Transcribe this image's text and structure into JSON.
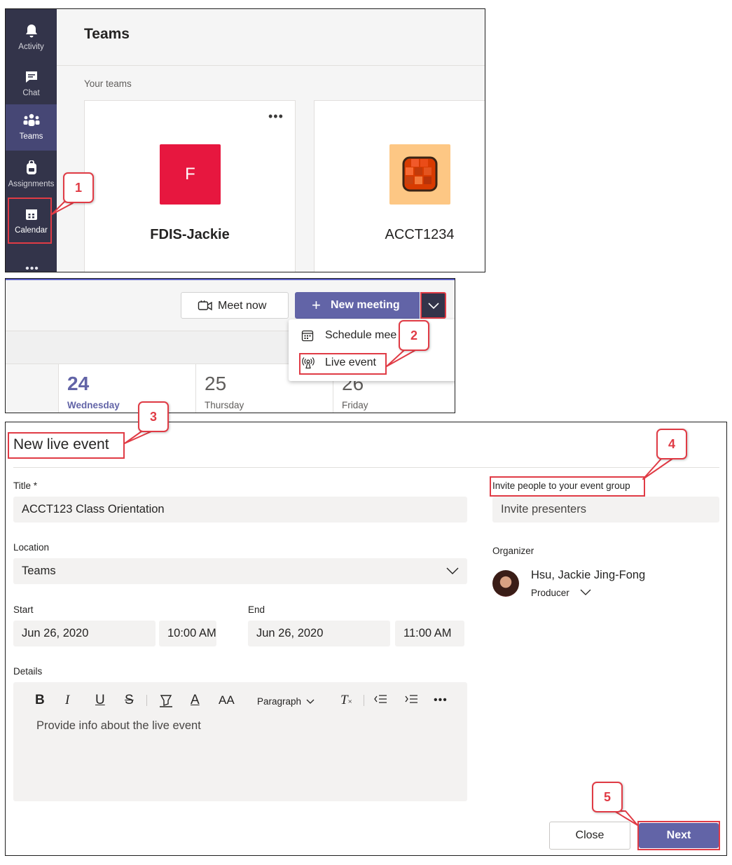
{
  "panel1": {
    "rail": [
      {
        "label": "Activity",
        "icon": "bell-icon"
      },
      {
        "label": "Chat",
        "icon": "chat-icon"
      },
      {
        "label": "Teams",
        "icon": "teams-icon"
      },
      {
        "label": "Assignments",
        "icon": "backpack-icon"
      },
      {
        "label": "Calendar",
        "icon": "calendar-icon"
      }
    ],
    "more": "•••",
    "title": "Teams",
    "section_label": "Your teams",
    "cards": [
      {
        "name": "FDIS-Jackie",
        "avatar_letter": "F",
        "avatar_color": "#e7173f",
        "more": "•••"
      },
      {
        "name": "ACCT1234",
        "avatar_color": "#fdc784"
      }
    ]
  },
  "panel2": {
    "meet_now": "Meet now",
    "new_meeting": "New meeting",
    "menu": [
      {
        "label": "Schedule mee",
        "icon": "calendar-grid-icon"
      },
      {
        "label": "Live event",
        "icon": "broadcast-icon"
      }
    ],
    "days": [
      {
        "num": "24",
        "name": "Wednesday"
      },
      {
        "num": "25",
        "name": "Thursday"
      },
      {
        "num": "26",
        "name": "Friday"
      }
    ]
  },
  "panel3": {
    "title": "New live event",
    "title_label": "Title *",
    "title_value": "ACCT123 Class Orientation",
    "location_label": "Location",
    "location_value": "Teams",
    "start_label": "Start",
    "start_date": "Jun 26, 2020",
    "start_time": "10:00 AM",
    "end_label": "End",
    "end_date": "Jun 26, 2020",
    "end_time": "11:00 AM",
    "details_label": "Details",
    "toolbar": {
      "bold": "B",
      "italic": "I",
      "underline": "U",
      "strike": "S",
      "font_color": "A",
      "font_size": "AA",
      "paragraph": "Paragraph",
      "clear": "T",
      "more": "•••"
    },
    "details_placeholder": "Provide info about the live event",
    "invite_label": "Invite people to your event group",
    "invite_placeholder": "Invite presenters",
    "organizer_label": "Organizer",
    "organizer_name": "Hsu, Jackie Jing-Fong",
    "organizer_role": "Producer",
    "close": "Close",
    "next": "Next"
  },
  "callouts": [
    "1",
    "2",
    "3",
    "4",
    "5"
  ],
  "accent_color": "#6264a7",
  "highlight_color": "#e03b45"
}
